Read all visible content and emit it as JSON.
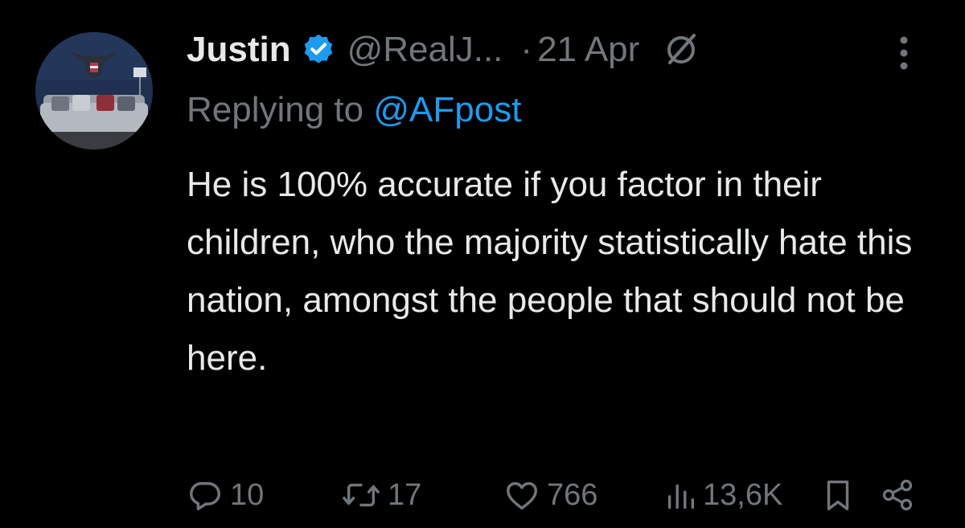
{
  "tweet": {
    "author_name": "Justin",
    "author_handle": "@RealJ...",
    "separator": "·",
    "date": "21 Apr",
    "reply_prefix": "Replying to",
    "reply_to": "@AFpost",
    "text": "He is 100% accurate if you factor in their children, who the majority statistically hate this nation, amongst the people that should not be here.",
    "stats": {
      "replies": "10",
      "retweets": "17",
      "likes": "766",
      "views": "13,6K"
    }
  },
  "icons": {
    "verified": "verified-badge-icon",
    "grok": "grok-icon",
    "more": "more-options-icon",
    "reply": "reply-icon",
    "retweet": "retweet-icon",
    "like": "heart-icon",
    "views": "views-icon",
    "bookmark": "bookmark-icon",
    "share": "share-icon"
  },
  "colors": {
    "background": "#000000",
    "text_primary": "#e7e9ea",
    "text_secondary": "#71767b",
    "accent": "#1d9bf0"
  }
}
